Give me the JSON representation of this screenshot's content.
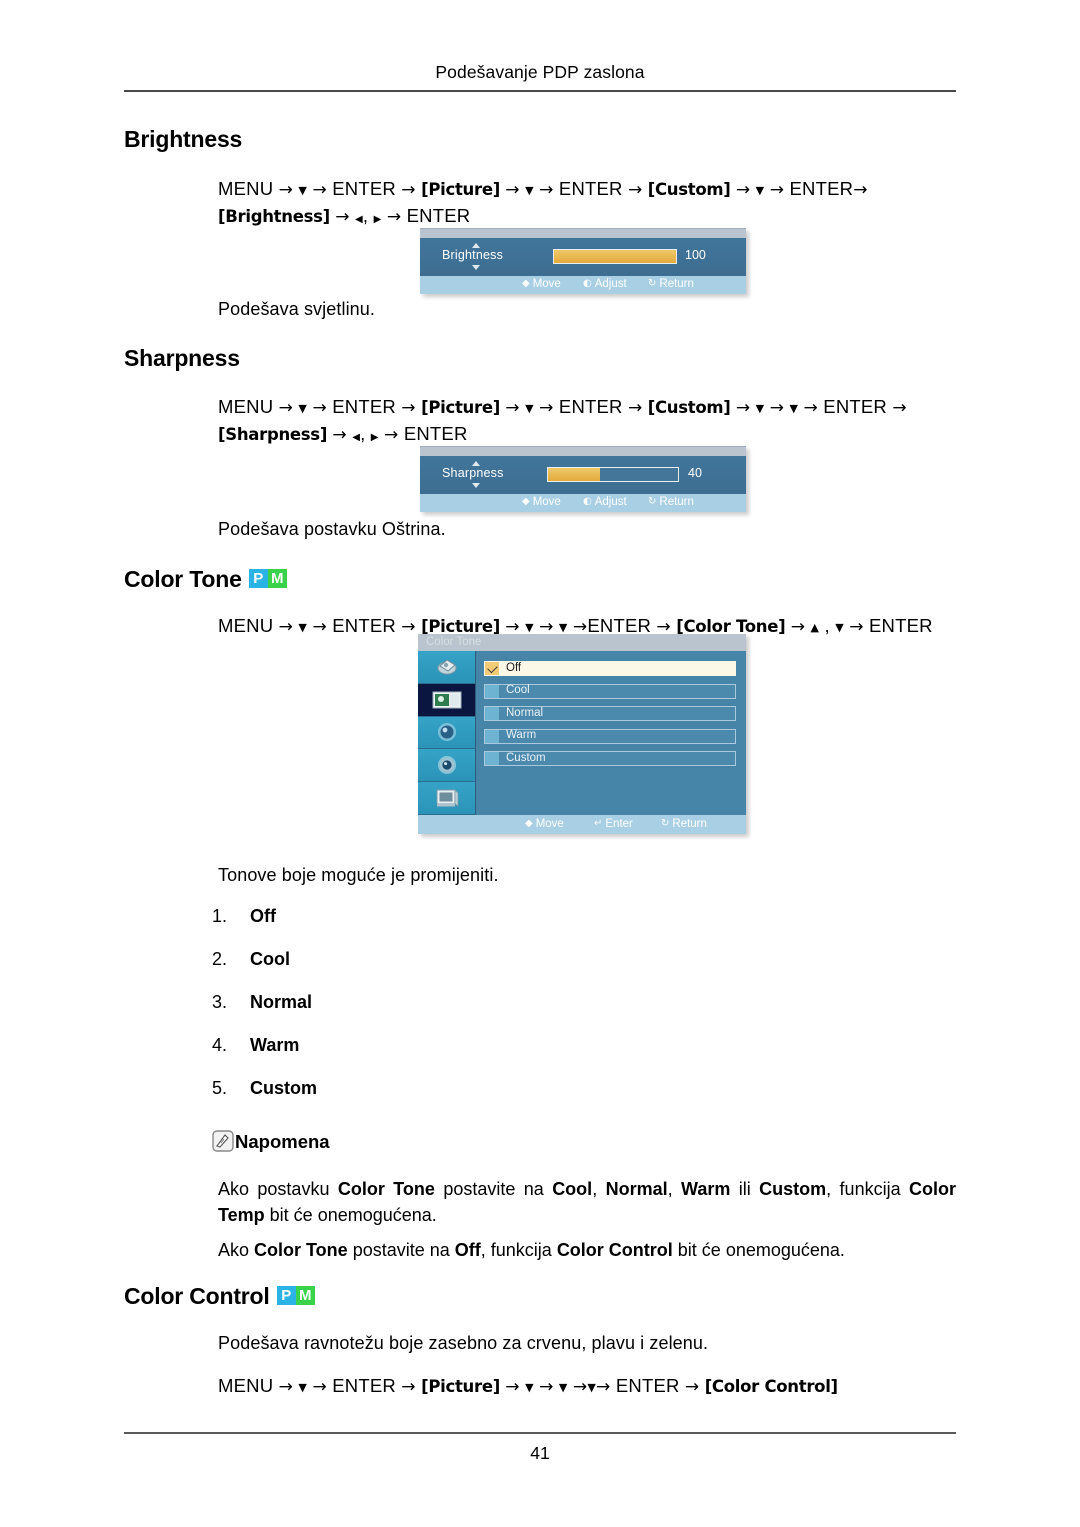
{
  "header": {
    "title": "Podešavanje PDP zaslona",
    "page_number": "41"
  },
  "badges": {
    "p_label": "P",
    "m_label": "M",
    "p_color": "#2bb3e5",
    "m_color": "#3ad24a"
  },
  "sections": {
    "brightness": {
      "heading": "Brightness",
      "path": {
        "menu": "MENU",
        "enter": "ENTER",
        "picture": "[Picture]",
        "custom": "[Custom]",
        "item": "[Brightness]"
      },
      "description": "Podešava svjetlinu.",
      "osd": {
        "label": "Brightness",
        "value": "100",
        "fill_percent": 100,
        "hints": [
          "Move",
          "Adjust",
          "Return"
        ]
      }
    },
    "sharpness": {
      "heading": "Sharpness",
      "path": {
        "menu": "MENU",
        "enter": "ENTER",
        "picture": "[Picture]",
        "custom": "[Custom]",
        "item": "[Sharpness]"
      },
      "description": "Podešava postavku Oštrina.",
      "osd": {
        "label": "Sharpness",
        "value": "40",
        "fill_percent": 40,
        "hints": [
          "Move",
          "Adjust",
          "Return"
        ]
      }
    },
    "color_tone": {
      "heading": "Color Tone",
      "path": {
        "menu": "MENU",
        "enter": "ENTER",
        "picture": "[Picture]",
        "item": "[Color Tone]"
      },
      "osd": {
        "title": "Color Tone",
        "options": [
          {
            "label": "Off",
            "selected": true
          },
          {
            "label": "Cool",
            "selected": false
          },
          {
            "label": "Normal",
            "selected": false
          },
          {
            "label": "Warm",
            "selected": false
          },
          {
            "label": "Custom",
            "selected": false
          }
        ],
        "sidebar_icons": [
          "input-source-icon",
          "picture-icon",
          "sound-icon",
          "setup-icon",
          "multi-control-icon"
        ],
        "selected_sidebar_index": 1,
        "hints": [
          "Move",
          "Enter",
          "Return"
        ]
      },
      "description": "Tonove boje moguće je promijeniti.",
      "list": [
        {
          "num": "1.",
          "label": "Off"
        },
        {
          "num": "2.",
          "label": "Cool"
        },
        {
          "num": "3.",
          "label": "Normal"
        },
        {
          "num": "4.",
          "label": "Warm"
        },
        {
          "num": "5.",
          "label": "Custom"
        }
      ],
      "note_title": "Napomena",
      "note_paragraph_1": {
        "pre": "Ako postavku ",
        "b1": "Color Tone",
        "mid1": " postavite na ",
        "b2": "Cool",
        "sep1": ", ",
        "b3": "Normal",
        "sep2": ", ",
        "b4": "Warm",
        "mid2": " ili ",
        "b5": "Custom",
        "mid3": ", funkcija ",
        "b6": "Color Temp",
        "post": " bit će onemogućena."
      },
      "note_paragraph_2": {
        "pre": "Ako ",
        "b1": "Color Tone",
        "mid1": " postavite na ",
        "b2": "Off",
        "mid2": ", funkcija ",
        "b3": "Color Control",
        "post": " bit će onemogućena."
      }
    },
    "color_control": {
      "heading": "Color Control",
      "description": "Podešava ravnotežu boje zasebno za crvenu, plavu i zelenu.",
      "path": {
        "menu": "MENU",
        "enter": "ENTER",
        "picture": "[Picture]",
        "item": "[Color Control]"
      }
    }
  },
  "glyphs": {
    "arrow_right": "→",
    "arrow_down": "▼",
    "arrow_up": "▲",
    "arrow_left_small": "◀",
    "arrow_right_small": "▶",
    "comma": ",",
    "move_glyph": "◆",
    "adjust_glyph": "◐",
    "return_glyph": "↻",
    "enter_glyph": "↵"
  }
}
